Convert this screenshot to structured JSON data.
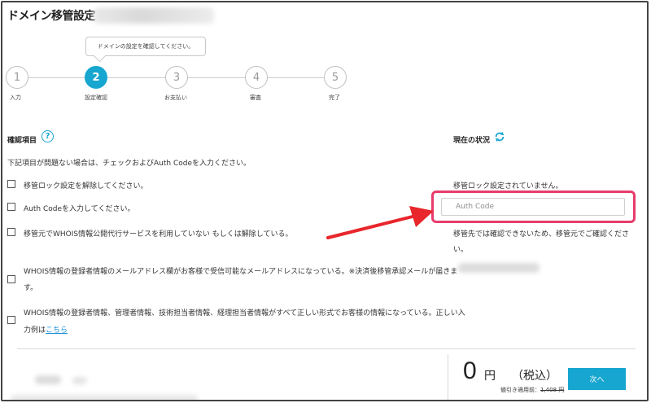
{
  "header": {
    "title": "ドメイン移管設定"
  },
  "tooltip": {
    "text": "ドメインの設定を確認してください。"
  },
  "steps": [
    {
      "num": "1",
      "label": "入力"
    },
    {
      "num": "2",
      "label": "設定確認",
      "active": true
    },
    {
      "num": "3",
      "label": "お支払い"
    },
    {
      "num": "4",
      "label": "審査"
    },
    {
      "num": "5",
      "label": "完了"
    }
  ],
  "section": {
    "title": "確認項目",
    "help_icon": "question-circle-icon",
    "status_title": "現在の状況",
    "refresh_icon": "refresh-icon",
    "instruction": "下記項目が問題ない場合は、チェックおよびAuth Codeを入力ください。"
  },
  "checklist": [
    {
      "text": "移管ロック設定を解除してください。",
      "status": "移管ロック設定されていません。"
    },
    {
      "text": "Auth Codeを入力してください。",
      "input_placeholder": "Auth Code"
    },
    {
      "text": "移管元でWHOIS情報公開代行サービスを利用していない もしくは解除している。",
      "status_line1": "移管先では確認できないため、移管元でご確認くださ",
      "status_line2": "い。"
    },
    {
      "line1": "WHOIS情報の登録者情報のメールアドレス欄がお客様で受信可能なメールアドレスになっている。※決済後移管承認メールが届きま",
      "line2": "す。"
    },
    {
      "line1": "WHOIS情報の登録者情報、管理者情報、技術担当者情報、経理担当者情報がすべて正しい形式でお客様の情報になっている。正しい入",
      "line2_prefix": "力例は",
      "link": "こちら"
    }
  ],
  "price": {
    "amount": "0",
    "unit": "円",
    "tax": "（税込）",
    "note_prefix": "値引き適用前：",
    "original": "1,408 円"
  },
  "next_button": "次へ",
  "colors": {
    "accent": "#17a6cf",
    "highlight": "#e83c6c",
    "arrow": "#e8262c"
  }
}
